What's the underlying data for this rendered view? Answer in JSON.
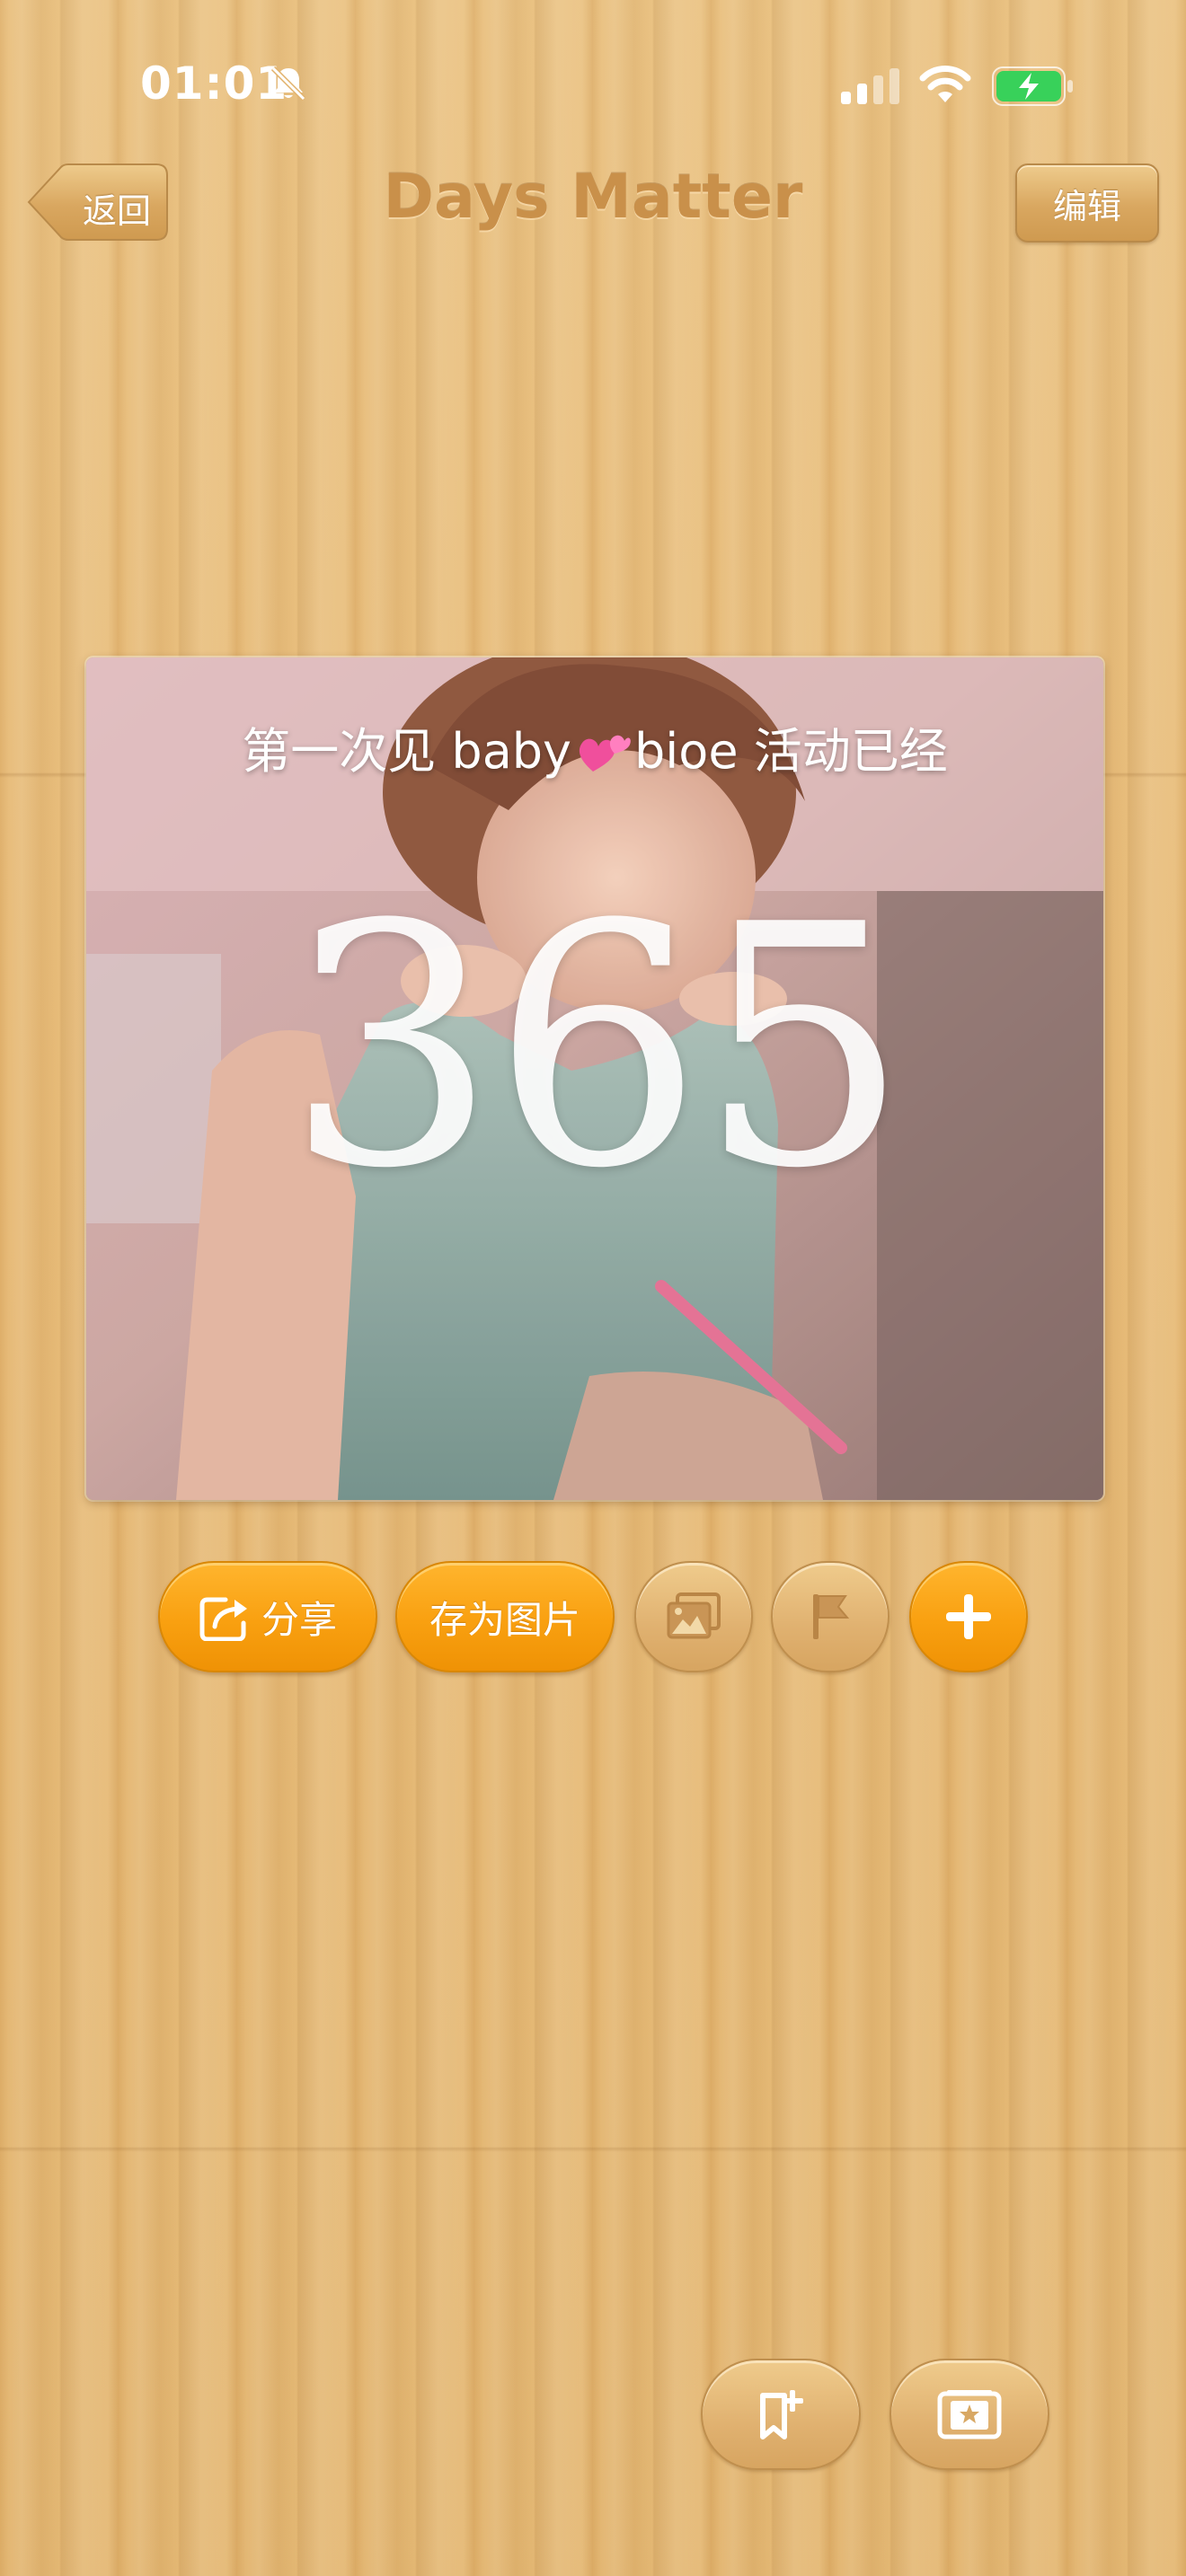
{
  "status_bar": {
    "time": "01:01",
    "icons": [
      "bell-slash-icon",
      "cellular-signal-icon",
      "wifi-icon",
      "battery-charging-icon"
    ],
    "battery_color": "#38d15a"
  },
  "nav": {
    "back_label": "返回",
    "title": "Days Matter",
    "edit_label": "编辑"
  },
  "card": {
    "title_prefix": "第一次见 baby",
    "title_emoji_icon": "two-hearts-icon",
    "title_suffix": "bioe 活动已经",
    "day_count": "365"
  },
  "actions": {
    "share_label": "分享",
    "save_image_label": "存为图片",
    "buttons": [
      "share-icon",
      "background-image-icon",
      "flag-icon",
      "plus-icon"
    ]
  },
  "bottom": {
    "buttons": [
      "add-bookmark-icon",
      "photo-gallery-icon"
    ]
  },
  "colors": {
    "wood": "#e3b46f",
    "accent_orange": "#f9a010",
    "title_brown": "#c9904a"
  }
}
